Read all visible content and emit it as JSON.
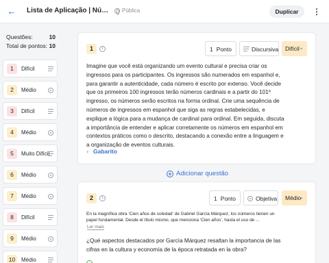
{
  "header": {
    "back_icon": "arrow-left-icon",
    "title": "Lista de Aplicação | Números Ordinais",
    "visibility": "Pública",
    "duplicate_label": "Duplicar",
    "menu_icon": "more-vertical-icon"
  },
  "sidebar": {
    "questions_label": "Questões:",
    "questions_count": "10",
    "points_label": "Total de pontos:",
    "points_count": "10",
    "items": [
      {
        "num": "1",
        "difficulty": "Difícil",
        "type_icon": "lines-icon"
      },
      {
        "num": "2",
        "difficulty": "Médio",
        "type_icon": "radio-icon"
      },
      {
        "num": "3",
        "difficulty": "Difícil",
        "type_icon": "lines-icon"
      },
      {
        "num": "4",
        "difficulty": "Médio",
        "type_icon": "radio-icon"
      },
      {
        "num": "5",
        "difficulty": "Muito Difícil",
        "type_icon": "lines-icon"
      },
      {
        "num": "6",
        "difficulty": "Médio",
        "type_icon": "radio-icon"
      },
      {
        "num": "7",
        "difficulty": "Médio",
        "type_icon": "radio-icon"
      },
      {
        "num": "8",
        "difficulty": "Difícil",
        "type_icon": "lines-icon"
      },
      {
        "num": "9",
        "difficulty": "Médio",
        "type_icon": "radio-icon"
      },
      {
        "num": "10",
        "difficulty": "Médio",
        "type_icon": "lines-icon"
      }
    ]
  },
  "question1": {
    "number": "1",
    "points_value": "1",
    "points_unit": "Ponto",
    "type_label": "Discursiva",
    "difficulty": "Difícil",
    "text": "Imagine que você está organizando um evento cultural e precisa criar os ingressos para os participantes. Os ingressos são numerados em espanhol e, para garantir a autenticidade, cada número é escrito por extenso. Você decide que os primeiros 100 ingressos terão números cardinais e a partir do 101º ingresso, os números serão escritos na forma ordinal. Crie uma sequência de números de ingressos em espanhol que siga as regras estabelecidas, e explique a lógica para a mudança de cardinal para ordinal. Em seguida, discuta a importância de entender e aplicar corretamente os números em espanhol em contextos práticos como o descrito, destacando a conexão entre a linguagem e a organização de eventos culturais.",
    "answer_label": "Gabarito"
  },
  "add_question_label": "Adicionar questão",
  "question2": {
    "number": "2",
    "points_value": "1",
    "points_unit": "Ponto",
    "type_label": "Objetiva",
    "difficulty": "Médio",
    "passage": "En la magnífica obra 'Cien años de soledad' de Gabriel García Márquez, los números tienen un papel fundamental. Desde el título mismo, que menciona 'Cien años', hasta el uso de ...",
    "read_more": "Ler mais",
    "text": "¿Qué aspectos destacados por García Márquez resaltan la importancia de las cifras en la cultura y economía de la época retratada en la obra?"
  }
}
